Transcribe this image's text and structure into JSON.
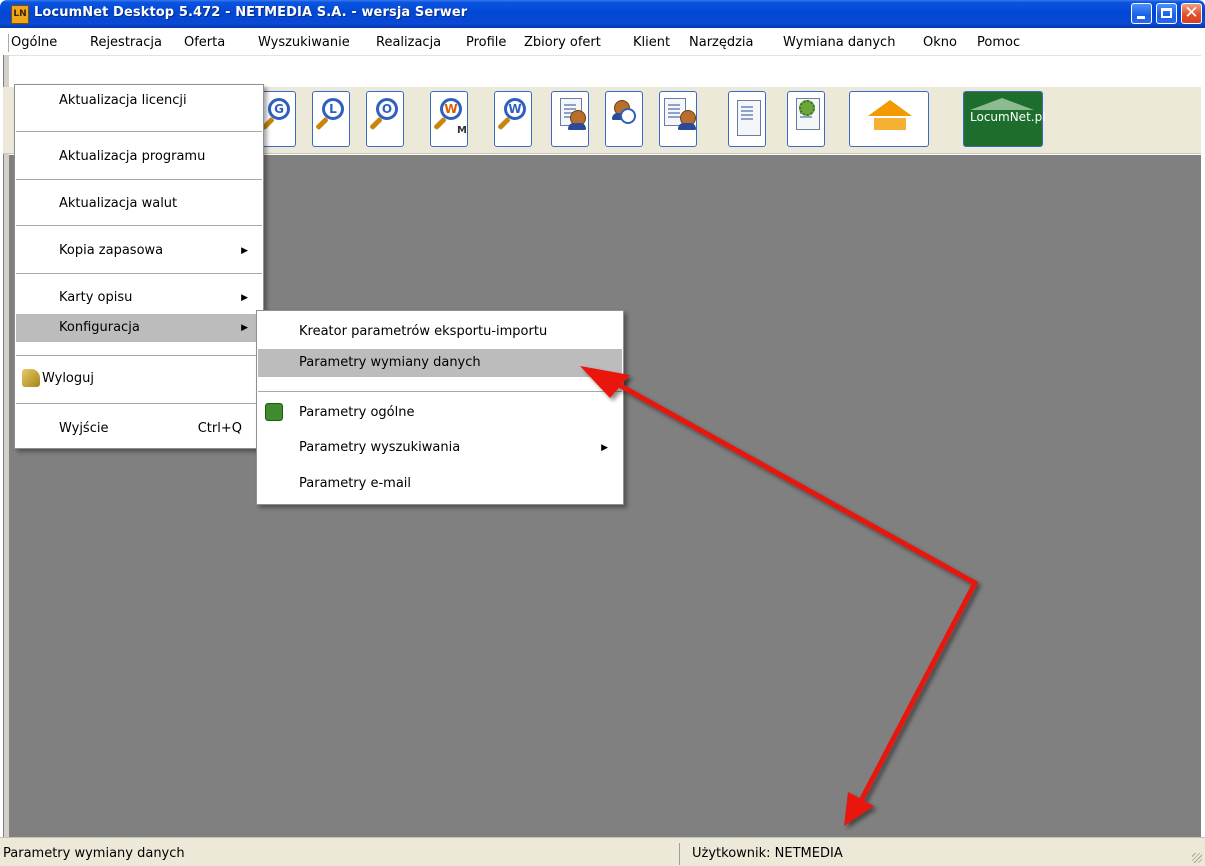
{
  "window": {
    "title": "LocumNet Desktop 5.472 - NETMEDIA S.A. - wersja Serwer",
    "app_icon_text": "LN"
  },
  "menubar": {
    "items": [
      "Ogólne",
      "Rejestracja",
      "Oferta",
      "Wyszukiwanie",
      "Realizacja",
      "Profile",
      "Zbiory ofert",
      "Klient",
      "Narzędzia",
      "Wymiana danych",
      "Okno",
      "Pomoc"
    ]
  },
  "toolbar": {
    "buttons": [
      {
        "icon": "search-g-icon",
        "letter": "G"
      },
      {
        "icon": "search-l-icon",
        "letter": "L"
      },
      {
        "icon": "search-o-icon",
        "letter": "O"
      },
      {
        "icon": "search-wm-icon",
        "letter": "W",
        "sub": "M"
      },
      {
        "icon": "search-w-icon",
        "letter": "W"
      },
      {
        "icon": "client-document-icon"
      },
      {
        "icon": "client-search-icon"
      },
      {
        "icon": "documents-client-icon"
      },
      {
        "icon": "report-document-icon"
      },
      {
        "icon": "settings-gear-icon"
      },
      {
        "icon": "houses-icon"
      },
      {
        "icon": "locumnet-logo-icon",
        "label": "LocumNet.pl"
      }
    ]
  },
  "main_menu": {
    "items": [
      {
        "label": "Aktualizacja licencji"
      },
      {
        "label": "Aktualizacja programu"
      },
      {
        "label": "Aktualizacja walut"
      },
      {
        "label": "Kopia zapasowa"
      },
      {
        "label": "Karty opisu"
      },
      {
        "label": "Konfiguracja"
      },
      {
        "label": "Wyloguj"
      },
      {
        "label": "Wyjście",
        "shortcut": "Ctrl+Q"
      }
    ]
  },
  "sub_menu": {
    "items": [
      {
        "label": "Kreator parametrów eksportu-importu"
      },
      {
        "label": "Parametry wymiany danych"
      },
      {
        "label": "Parametry ogólne"
      },
      {
        "label": "Parametry wyszukiwania"
      },
      {
        "label": "Parametry e-mail"
      }
    ]
  },
  "statusbar": {
    "left": "Parametry wymiany danych",
    "right": "Użytkownik: NETMEDIA"
  },
  "colors": {
    "titlebar": "#0046d5",
    "workspace": "#808080",
    "menu_highlight": "#bcbcbc",
    "annotation_arrow": "#e8140c"
  }
}
